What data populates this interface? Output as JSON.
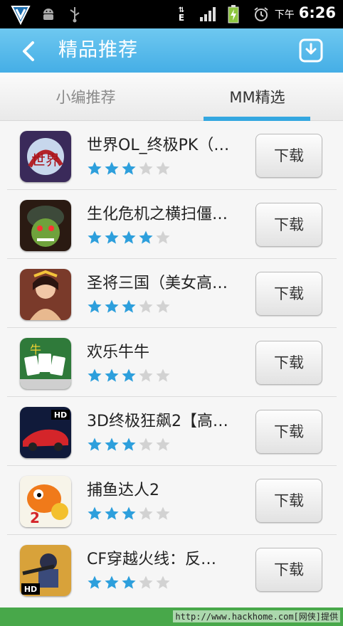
{
  "status_bar": {
    "ampm": "下午",
    "time": "6:26",
    "data_indicator": "E"
  },
  "header": {
    "title": "精品推荐"
  },
  "tabs": [
    {
      "label": "小编推荐",
      "selected": false
    },
    {
      "label": "MM精选",
      "selected": true
    }
  ],
  "apps": [
    {
      "name": "世界OL_终极PK（…",
      "rating": 3,
      "button": "下载"
    },
    {
      "name": "生化危机之横扫僵…",
      "rating": 4,
      "button": "下载"
    },
    {
      "name": "圣将三国（美女高…",
      "rating": 3,
      "button": "下载"
    },
    {
      "name": "欢乐牛牛",
      "rating": 3,
      "button": "下载"
    },
    {
      "name": "3D终极狂飙2【高…",
      "rating": 3,
      "button": "下载"
    },
    {
      "name": "捕鱼达人2",
      "rating": 3,
      "button": "下载"
    },
    {
      "name": "CF穿越火线：反…",
      "rating": 3,
      "button": "下载"
    }
  ],
  "rating_max": 5,
  "colors": {
    "accent": "#34a7e0",
    "star_on": "#2d9fdc",
    "star_off": "#d2d2d2",
    "footer": "#48a84a"
  },
  "watermark": "http://www.hackhome.com[网侠]提供"
}
